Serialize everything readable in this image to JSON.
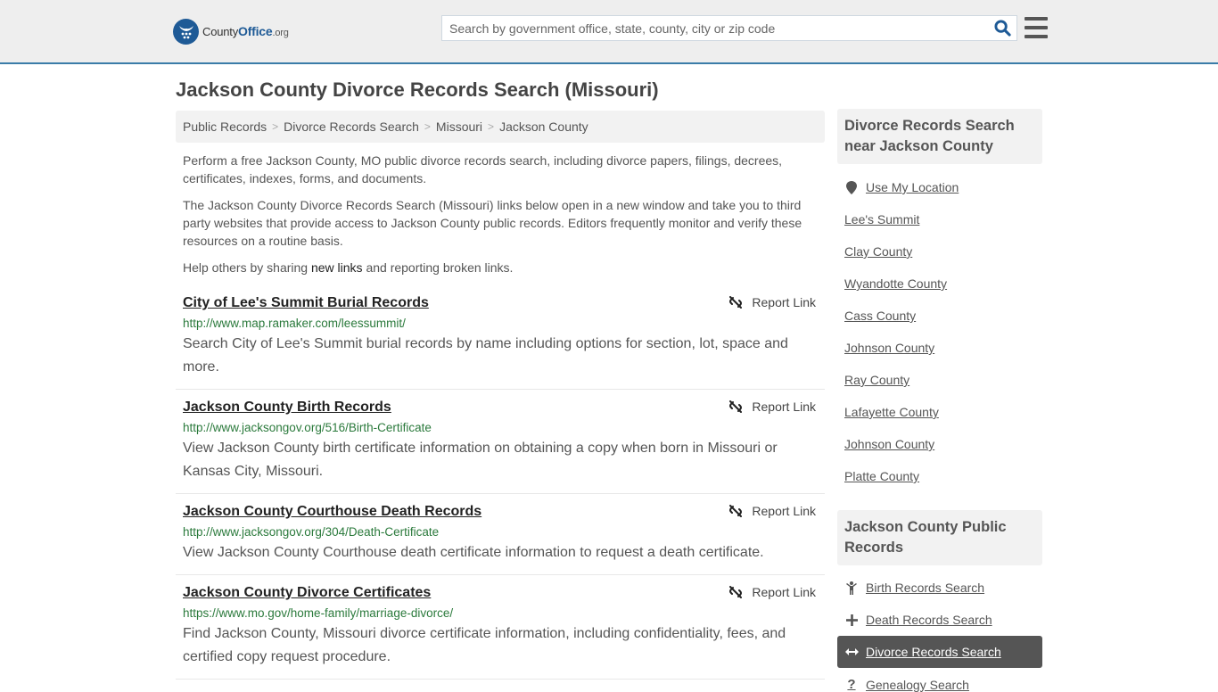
{
  "header": {
    "logo": {
      "brand_prefix": "County",
      "brand_main": "Office",
      "brand_suffix": ".org"
    },
    "search": {
      "placeholder": "Search by government office, state, county, city or zip code",
      "value": ""
    },
    "colors": {
      "accent": "#1e5a96",
      "border": "#3a7ca8"
    }
  },
  "page": {
    "title": "Jackson County Divorce Records Search (Missouri)",
    "breadcrumb": [
      "Public Records",
      "Divorce Records Search",
      "Missouri",
      "Jackson County"
    ],
    "intro": {
      "p1": "Perform a free Jackson County, MO public divorce records search, including divorce papers, filings, decrees, certificates, indexes, forms, and documents.",
      "p2": "The Jackson County Divorce Records Search (Missouri) links below open in a new window and take you to third party websites that provide access to Jackson County public records. Editors frequently monitor and verify these resources on a routine basis.",
      "p3_before": "Help others by sharing ",
      "p3_link": "new links",
      "p3_after": " and reporting broken links."
    },
    "report_label": "Report Link",
    "results": [
      {
        "title": "City of Lee's Summit Burial Records",
        "url": "http://www.map.ramaker.com/leessummit/",
        "description": "Search City of Lee's Summit burial records by name including options for section, lot, space and more."
      },
      {
        "title": "Jackson County Birth Records",
        "url": "http://www.jacksongov.org/516/Birth-Certificate",
        "description": "View Jackson County birth certificate information on obtaining a copy when born in Missouri or Kansas City, Missouri."
      },
      {
        "title": "Jackson County Courthouse Death Records",
        "url": "http://www.jacksongov.org/304/Death-Certificate",
        "description": "View Jackson County Courthouse death certificate information to request a death certificate."
      },
      {
        "title": "Jackson County Divorce Certificates",
        "url": "https://www.mo.gov/home-family/marriage-divorce/",
        "description": "Find Jackson County, Missouri divorce certificate information, including confidentiality, fees, and certified copy request procedure."
      }
    ]
  },
  "sidebar": {
    "nearby": {
      "heading": "Divorce Records Search near Jackson County",
      "use_location": "Use My Location",
      "items": [
        "Lee's Summit",
        "Clay County",
        "Wyandotte County",
        "Cass County",
        "Johnson County",
        "Ray County",
        "Lafayette County",
        "Johnson County",
        "Platte County"
      ]
    },
    "public_records": {
      "heading": "Jackson County Public Records",
      "items": [
        {
          "label": "Birth Records Search",
          "icon": "child-icon",
          "active": false
        },
        {
          "label": "Death Records Search",
          "icon": "cross-icon",
          "active": false
        },
        {
          "label": "Divorce Records Search",
          "icon": "arrows-horizontal-icon",
          "active": true
        },
        {
          "label": "Genealogy Search",
          "icon": "question-icon",
          "active": false
        }
      ]
    }
  }
}
